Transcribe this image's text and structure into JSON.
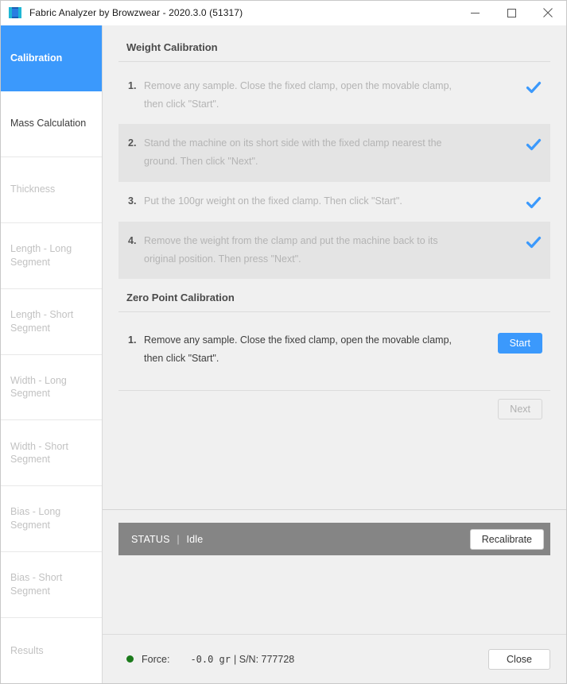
{
  "window": {
    "title": "Fabric Analyzer by Browzwear - 2020.3.0 (51317)",
    "app_icon": "fabric-roll-icon",
    "controls": {
      "minimize": "minimize-icon",
      "maximize": "maximize-icon",
      "close": "close-icon"
    },
    "accent_color": "#3b99fc"
  },
  "sidebar": {
    "items": [
      {
        "label": "Calibration",
        "state": "active"
      },
      {
        "label": "Mass Calculation",
        "state": "enabled"
      },
      {
        "label": "Thickness",
        "state": "disabled"
      },
      {
        "label": "Length - Long Segment",
        "state": "disabled"
      },
      {
        "label": "Length - Short Segment",
        "state": "disabled"
      },
      {
        "label": "Width - Long Segment",
        "state": "disabled"
      },
      {
        "label": "Width - Short Segment",
        "state": "disabled"
      },
      {
        "label": "Bias - Long Segment",
        "state": "disabled"
      },
      {
        "label": "Bias - Short Segment",
        "state": "disabled"
      },
      {
        "label": "Results",
        "state": "disabled"
      }
    ]
  },
  "weight_calibration": {
    "title": "Weight Calibration",
    "steps": [
      {
        "number": "1.",
        "text": "Remove any sample. Close the fixed clamp, open the movable clamp, then click \"Start\".",
        "status_icon": "check-icon",
        "completed": true
      },
      {
        "number": "2.",
        "text": "Stand the machine on its short side with the fixed clamp nearest the ground. Then click \"Next\".",
        "status_icon": "check-icon",
        "completed": true
      },
      {
        "number": "3.",
        "text": "Put the 100gr weight on the fixed clamp. Then click \"Start\".",
        "status_icon": "check-icon",
        "completed": true
      },
      {
        "number": "4.",
        "text": "Remove the weight from the clamp and put the machine back to its original position. Then press \"Next\".",
        "status_icon": "check-icon",
        "completed": true
      }
    ]
  },
  "zero_point_calibration": {
    "title": "Zero Point Calibration",
    "steps": [
      {
        "number": "1.",
        "text": "Remove any sample. Close the fixed clamp, open the movable clamp, then click \"Start\".",
        "button_label": "Start"
      }
    ],
    "next_label": "Next"
  },
  "status": {
    "label": "STATUS",
    "separator": "|",
    "value": "Idle",
    "recalibrate_label": "Recalibrate",
    "background_color": "#858585"
  },
  "footer": {
    "indicator": "status-dot-green",
    "indicator_color": "#1b7a1b",
    "force_label": "Force:",
    "force_value": "-0.0 gr",
    "serial_text": "| S/N: 777728",
    "close_label": "Close"
  }
}
